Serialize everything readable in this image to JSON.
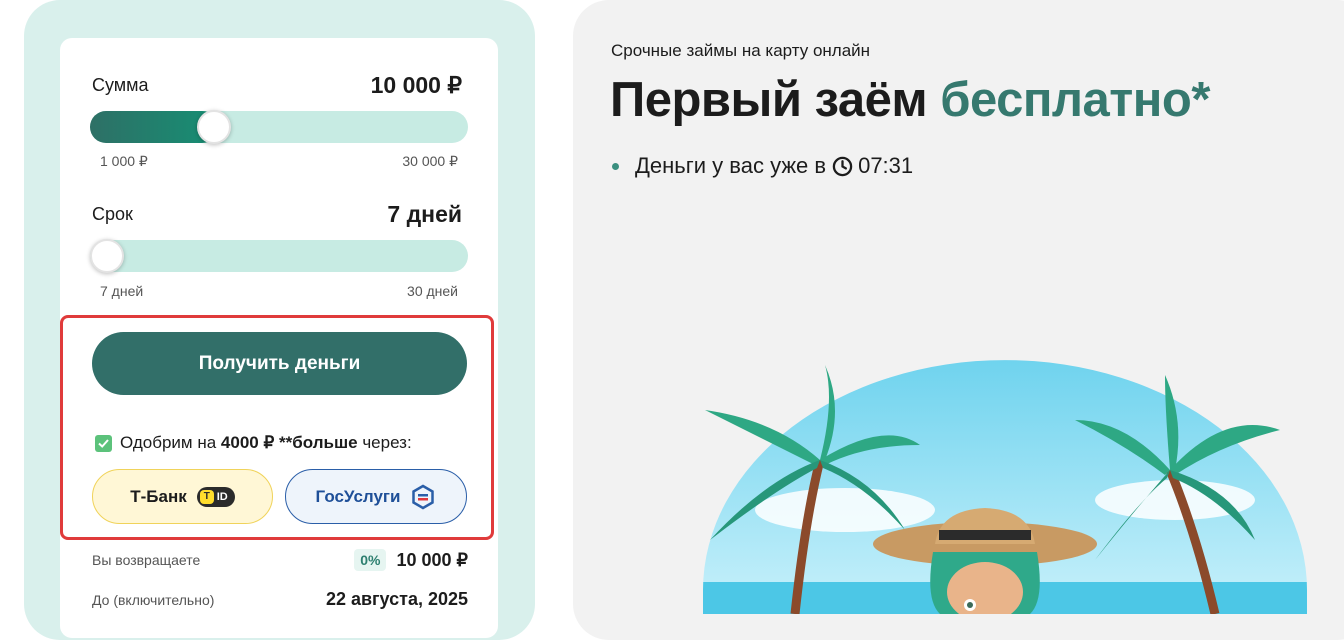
{
  "calculator": {
    "amount": {
      "label": "Сумма",
      "value": "10 000 ₽",
      "min_label": "1 000 ₽",
      "max_label": "30 000 ₽",
      "level": 0.31
    },
    "term": {
      "label": "Срок",
      "value": "7 дней",
      "min_label": "7 дней",
      "max_label": "30 дней",
      "level": 0.0
    },
    "submit_label": "Получить деньги",
    "approve": {
      "checked": true,
      "prefix": "Одобрим на",
      "amount": "4000 ₽",
      "mid": "**больше",
      "suffix": "через:"
    },
    "providers": {
      "tbank": "Т-Банк",
      "tbank_badge": "ID",
      "gosuslugi": "ГосУслуги"
    },
    "summary": {
      "return_label": "Вы возвращаете",
      "rate": "0%",
      "return_value": "10 000 ₽",
      "until_label": "До (включительно)",
      "until_value": "22 августа, 2025"
    }
  },
  "promo": {
    "subtitle": "Срочные займы на карту онлайн",
    "headline_main": "Первый заём",
    "headline_accent": "бесплатно*",
    "bullet_text": "Деньги у вас уже в",
    "timer": "07:31"
  },
  "colors": {
    "brand": "#326f69",
    "accent_text": "#36796f",
    "slider_track": "#c7ebe3",
    "panel_bg": "#d9f0ec",
    "highlight": "#e03b3b"
  },
  "icons": [
    "checkbox-check-icon",
    "tbank-id-icon",
    "gosuslugi-logo-icon",
    "clock-icon",
    "beach-illustration"
  ]
}
